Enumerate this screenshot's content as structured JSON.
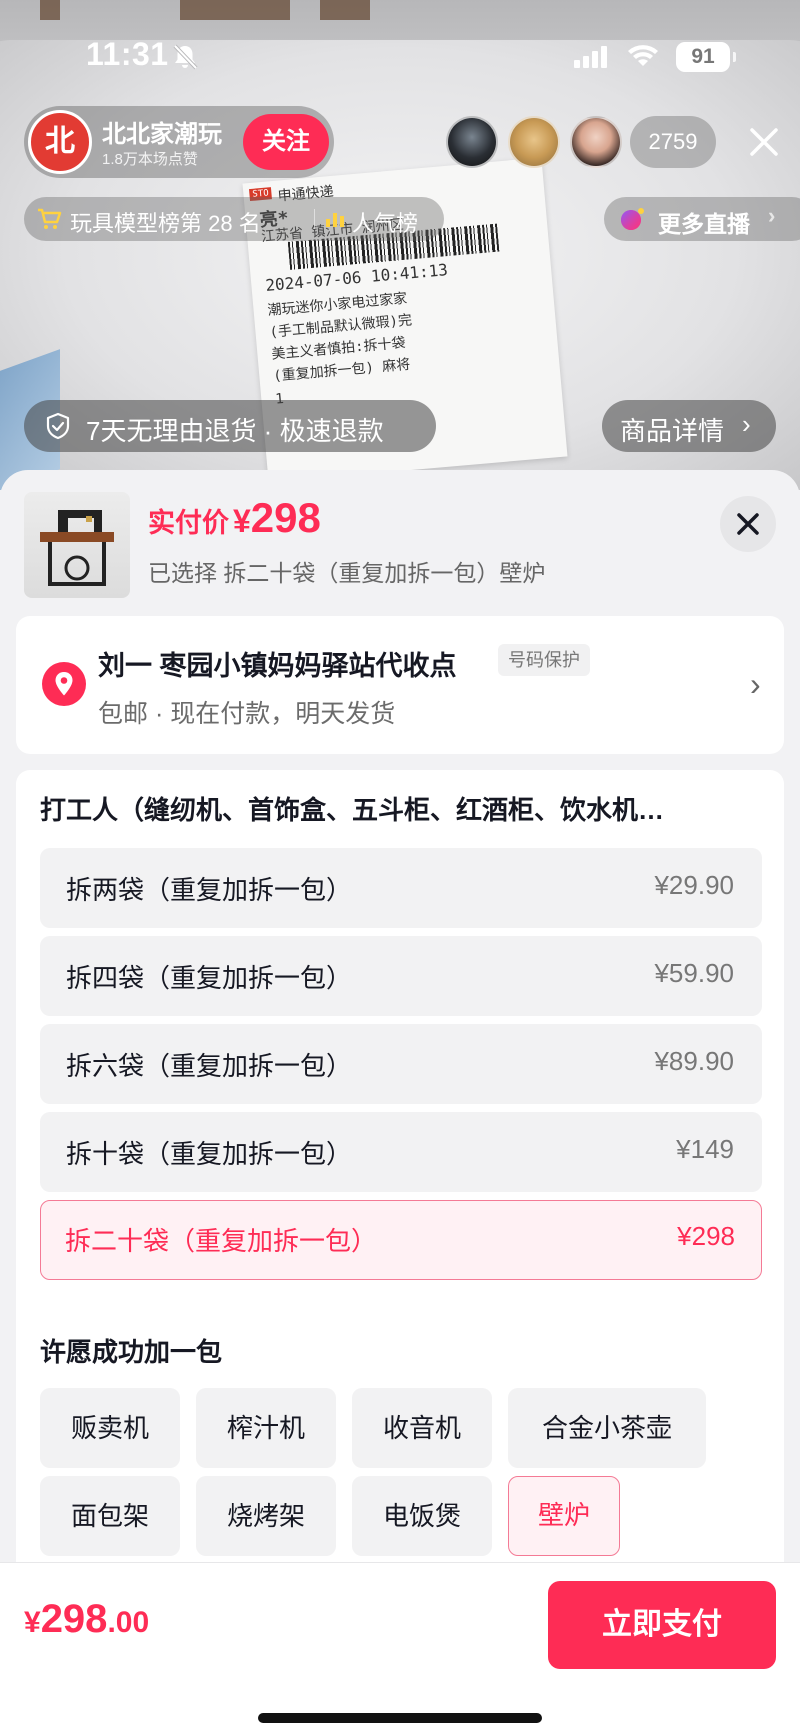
{
  "status_bar": {
    "time": "11:31",
    "battery": "91"
  },
  "streamer": {
    "avatar_text": "北",
    "name": "北北家潮玩",
    "likes": "1.8万本场点赞",
    "follow_label": "关注"
  },
  "viewers": {
    "count": "2759"
  },
  "rank": {
    "text": "玩具模型榜第 28 名",
    "popularity_label": "人气榜"
  },
  "more_live": {
    "label": "更多直播",
    "arrow": "›"
  },
  "waybill": {
    "courier": "申通快递",
    "courier_tag": "STO",
    "receiver": "亮*",
    "address": "江苏省 镇江市 润州区",
    "datetime": "2024-07-06 10:41:13",
    "note_lines": [
      "潮玩迷你小家电过家家",
      "(手工制品默认微瑕)完",
      "美主义者慎拍:拆十袋",
      "(重复加拆一包) 麻将",
      "1"
    ]
  },
  "return_policy": {
    "text": "7天无理由退货 · 极速退款"
  },
  "product_detail": {
    "label": "商品详情",
    "arrow": "›"
  },
  "sheet": {
    "price_label": "实付价",
    "currency": "¥",
    "price": "298",
    "selected_text": "已选择 拆二十袋（重复加拆一包）壁炉",
    "close_symbol": "✕"
  },
  "address": {
    "name_line": "刘一  枣园小镇妈妈驿站代收点",
    "badge": "号码保护",
    "sub_line": "包邮 · 现在付款，明天发货",
    "chevron": "›"
  },
  "spec": {
    "title": "打工人（缝纫机、首饰盒、五斗柜、红酒柜、饮水机…",
    "options": [
      {
        "label": "拆两袋（重复加拆一包）",
        "price": "¥29.90"
      },
      {
        "label": "拆四袋（重复加拆一包）",
        "price": "¥59.90"
      },
      {
        "label": "拆六袋（重复加拆一包）",
        "price": "¥89.90"
      },
      {
        "label": "拆十袋（重复加拆一包）",
        "price": "¥149"
      },
      {
        "label": "拆二十袋（重复加拆一包）",
        "price": "¥298",
        "selected": true
      }
    ]
  },
  "wish": {
    "title": "许愿成功加一包",
    "chips": [
      {
        "label": "贩卖机"
      },
      {
        "label": "榨汁机"
      },
      {
        "label": "收音机"
      },
      {
        "label": "合金小茶壶"
      },
      {
        "label": "面包架"
      },
      {
        "label": "烧烤架"
      },
      {
        "label": "电饭煲"
      },
      {
        "label": "壁炉",
        "selected": true
      }
    ]
  },
  "footer": {
    "currency": "¥",
    "total_int": "298",
    "total_dec": ".00",
    "pay_label": "立即支付"
  },
  "colors": {
    "accent": "#fe2c55",
    "selected_bg": "#fff1f4",
    "option_bg": "#f2f2f3"
  }
}
